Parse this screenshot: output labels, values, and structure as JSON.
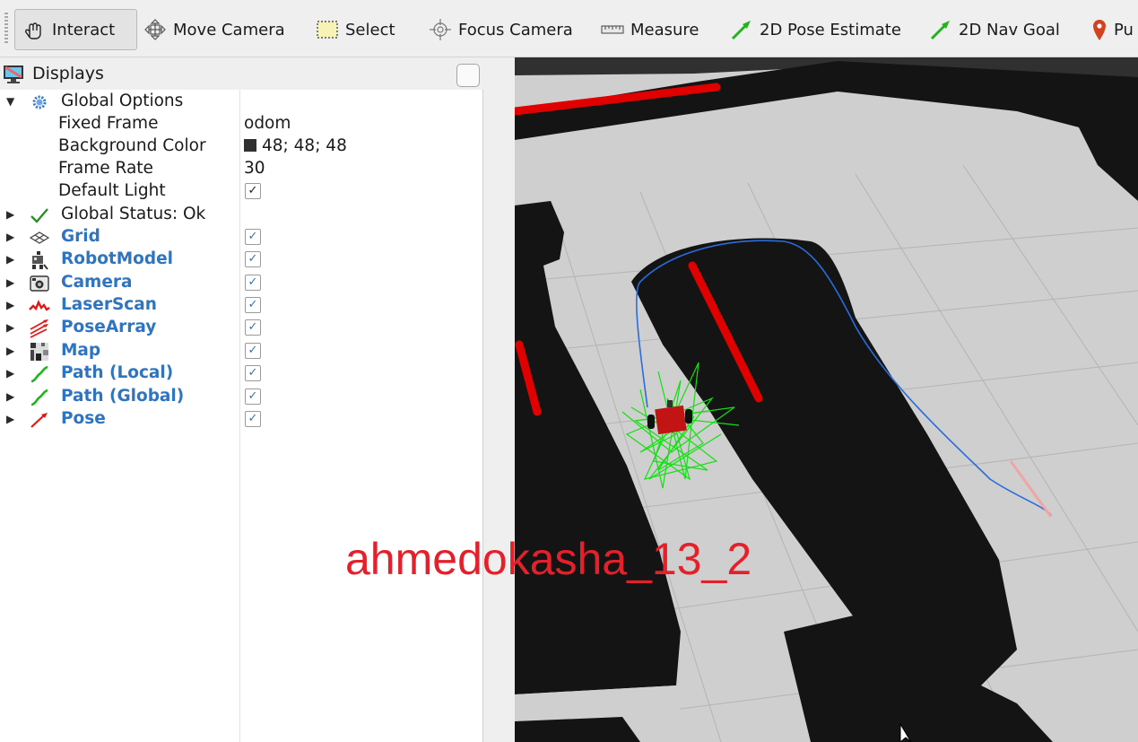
{
  "toolbar": {
    "tools": [
      {
        "label": "Interact",
        "icon": "hand-pointer-icon"
      },
      {
        "label": "Move Camera",
        "icon": "move-arrows-icon"
      },
      {
        "label": "Select",
        "icon": "select-box-icon"
      },
      {
        "label": "Focus Camera",
        "icon": "crosshair-icon"
      },
      {
        "label": "Measure",
        "icon": "ruler-icon"
      },
      {
        "label": "2D Pose Estimate",
        "icon": "green-arrow-icon"
      },
      {
        "label": "2D Nav Goal",
        "icon": "green-arrow-icon"
      },
      {
        "label": "Pu",
        "icon": "map-pin-icon"
      }
    ]
  },
  "displays": {
    "title": "Displays",
    "global_options": {
      "label": "Global Options",
      "fixed_frame_label": "Fixed Frame",
      "fixed_frame_value": "odom",
      "bg_color_label": "Background Color",
      "bg_color_value": "48; 48; 48",
      "bg_color_swatch": "#303030",
      "frame_rate_label": "Frame Rate",
      "frame_rate_value": "30",
      "default_light_label": "Default Light",
      "check_mark": "✓"
    },
    "global_status": "Global Status: Ok",
    "items": [
      {
        "label": "Grid",
        "icon": "grid-icon"
      },
      {
        "label": "RobotModel",
        "icon": "robot-icon"
      },
      {
        "label": "Camera",
        "icon": "camera-icon"
      },
      {
        "label": "LaserScan",
        "icon": "laser-scan-icon"
      },
      {
        "label": "PoseArray",
        "icon": "pose-array-icon"
      },
      {
        "label": "Map",
        "icon": "map-icon"
      },
      {
        "label": "Path (Local)",
        "icon": "path-icon"
      },
      {
        "label": "Path (Global)",
        "icon": "path-icon"
      },
      {
        "label": "Pose",
        "icon": "pose-icon"
      }
    ],
    "check_mark": "✓"
  },
  "viewport": {
    "background": "#303030"
  },
  "watermark": "ahmedokasha_13_2",
  "colors": {
    "item_blue": "#2f74c0",
    "laser_red": "#e00000",
    "path_global": "#2a6cdc",
    "pose_array_green": "#12e012"
  }
}
